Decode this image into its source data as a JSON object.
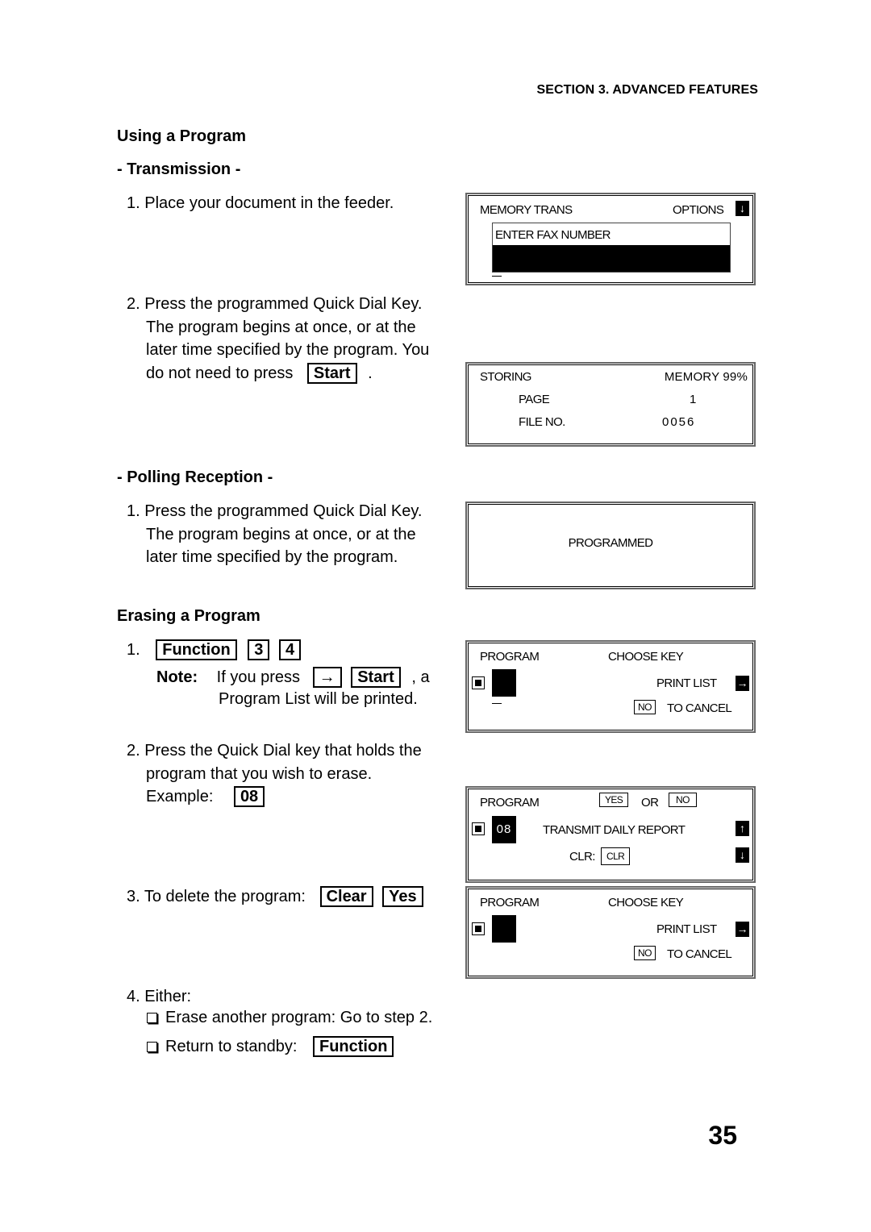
{
  "header": {
    "section_title": "SECTION 3. ADVANCED FEATURES"
  },
  "headings": {
    "using_program": "Using a Program",
    "transmission": "- Transmission -",
    "polling": "- Polling Reception -",
    "erasing": "Erasing a Program"
  },
  "transmission": {
    "step1": "1. Place your document in the feeder.",
    "step2_lines": [
      "2. Press the programmed Quick Dial Key.",
      "The program begins at once, or at the",
      "later time specified by the program. You"
    ],
    "step2_last_pre": "do not need to press",
    "step2_key": "Start",
    "step2_last_post": "."
  },
  "polling": {
    "step1_lines": [
      "1. Press the programmed Quick Dial Key.",
      "The program begins at once, or at the",
      "later time specified by the program."
    ]
  },
  "erasing": {
    "step1_num": "1.",
    "step1_keys": [
      "Function",
      "3",
      "4"
    ],
    "note_label": "Note:",
    "note_pre": "If you press",
    "note_key_arrow": "→",
    "note_key_start": "Start",
    "note_post": ", a",
    "note_line2": "Program List will be printed.",
    "step2_lines": [
      "2. Press the Quick Dial key that holds the",
      "program that you wish to erase."
    ],
    "example_label": "Example:",
    "example_key": "08",
    "step3_text": "3. To delete the program:",
    "step3_keys": [
      "Clear",
      "Yes"
    ],
    "step4_text": "4. Either:",
    "option1": "Erase another program: Go to step 2.",
    "option2_text": "Return to standby:",
    "option2_key": "Function"
  },
  "lcd": {
    "memory_trans": {
      "title": "MEMORY TRANS",
      "options": "OPTIONS",
      "prompt": "ENTER FAX NUMBER"
    },
    "storing": {
      "title": "STORING",
      "memory": "MEMORY 99%",
      "page_label": "PAGE",
      "page_value": "1",
      "file_label": "FILE NO.",
      "file_value": "0056"
    },
    "programmed": {
      "text": "PROGRAMMED"
    },
    "choose_key_1": {
      "title": "PROGRAM",
      "choose": "CHOOSE KEY",
      "print_list": "PRINT LIST",
      "no_key": "NO",
      "cancel": "TO CANCEL"
    },
    "confirm": {
      "title": "PROGRAM",
      "yes_key": "YES",
      "or": "OR",
      "no_key": "NO",
      "number": "08",
      "program_name": "TRANSMIT DAILY REPORT",
      "clr_label": "CLR:",
      "clr_key": "CLR"
    },
    "choose_key_2": {
      "title": "PROGRAM",
      "choose": "CHOOSE KEY",
      "print_list": "PRINT LIST",
      "no_key": "NO",
      "cancel": "TO CANCEL"
    }
  },
  "footer": {
    "page_number": "35"
  }
}
